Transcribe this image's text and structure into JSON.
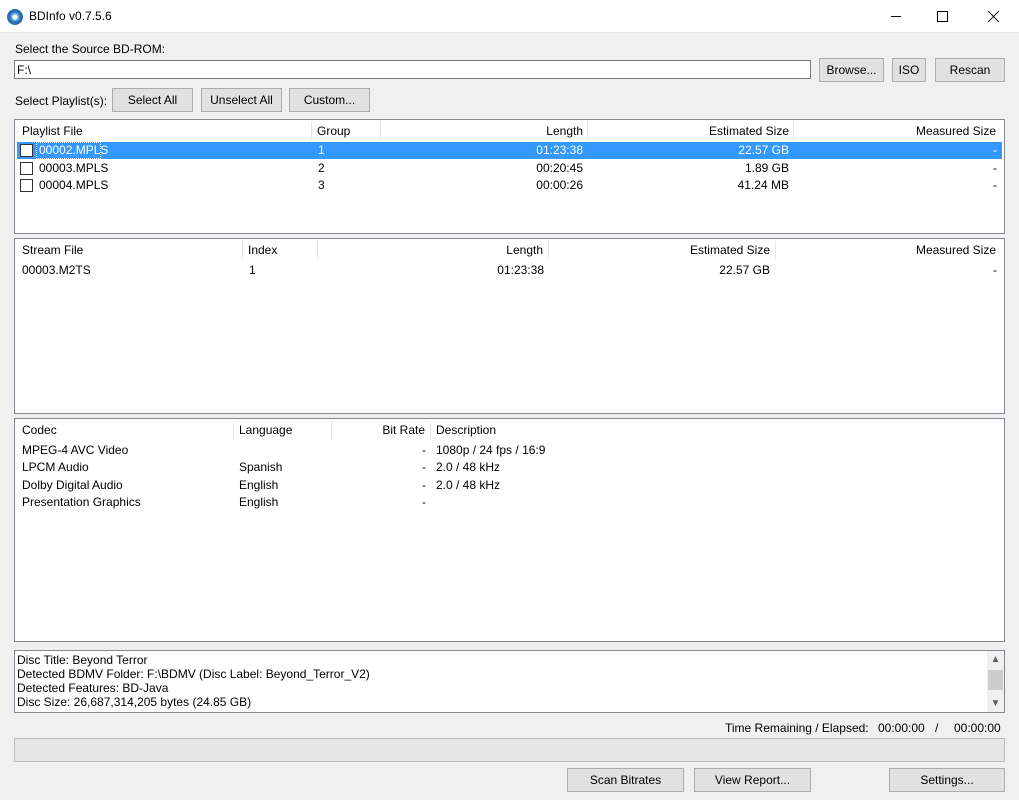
{
  "window": {
    "title": "BDInfo v0.7.5.6"
  },
  "source": {
    "label": "Select the Source BD-ROM:",
    "value": "F:\\"
  },
  "buttons": {
    "browse": "Browse...",
    "iso": "ISO",
    "rescan": "Rescan",
    "select_all": "Select All",
    "unselect_all": "Unselect All",
    "custom": "Custom...",
    "scan_bitrates": "Scan Bitrates",
    "view_report": "View Report...",
    "settings": "Settings..."
  },
  "playlist_label": "Select Playlist(s):",
  "playlists": {
    "headers": {
      "file": "Playlist File",
      "group": "Group",
      "length": "Length",
      "est": "Estimated Size",
      "meas": "Measured Size"
    },
    "rows": [
      {
        "file": "00002.MPLS",
        "group": "1",
        "length": "01:23:38",
        "est": "22.57 GB",
        "meas": "-"
      },
      {
        "file": "00003.MPLS",
        "group": "2",
        "length": "00:20:45",
        "est": "1.89 GB",
        "meas": "-"
      },
      {
        "file": "00004.MPLS",
        "group": "3",
        "length": "00:00:26",
        "est": "41.24 MB",
        "meas": "-"
      }
    ]
  },
  "streams": {
    "headers": {
      "file": "Stream File",
      "index": "Index",
      "length": "Length",
      "est": "Estimated Size",
      "meas": "Measured Size"
    },
    "rows": [
      {
        "file": "00003.M2TS",
        "index": "1",
        "length": "01:23:38",
        "est": "22.57 GB",
        "meas": "-"
      }
    ]
  },
  "codecs": {
    "headers": {
      "codec": "Codec",
      "language": "Language",
      "bitrate": "Bit Rate",
      "description": "Description"
    },
    "rows": [
      {
        "codec": "MPEG-4 AVC Video",
        "language": "",
        "bitrate": "-",
        "description": "1080p / 24 fps / 16:9"
      },
      {
        "codec": "LPCM Audio",
        "language": "Spanish",
        "bitrate": "-",
        "description": "2.0 / 48 kHz"
      },
      {
        "codec": "Dolby Digital Audio",
        "language": "English",
        "bitrate": "-",
        "description": "2.0 / 48 kHz"
      },
      {
        "codec": "Presentation Graphics",
        "language": "English",
        "bitrate": "-",
        "description": ""
      }
    ]
  },
  "disc_info": [
    "Disc Title: Beyond Terror",
    "Detected BDMV Folder: F:\\BDMV (Disc Label: Beyond_Terror_V2)",
    "Detected Features: BD-Java",
    "Disc Size: 26,687,314,205 bytes (24.85 GB)"
  ],
  "status": {
    "time_label": "Time Remaining / Elapsed:",
    "remaining": "00:00:00",
    "separator": "/",
    "elapsed": "00:00:00"
  },
  "colors": {
    "selection": "#3399ff"
  }
}
